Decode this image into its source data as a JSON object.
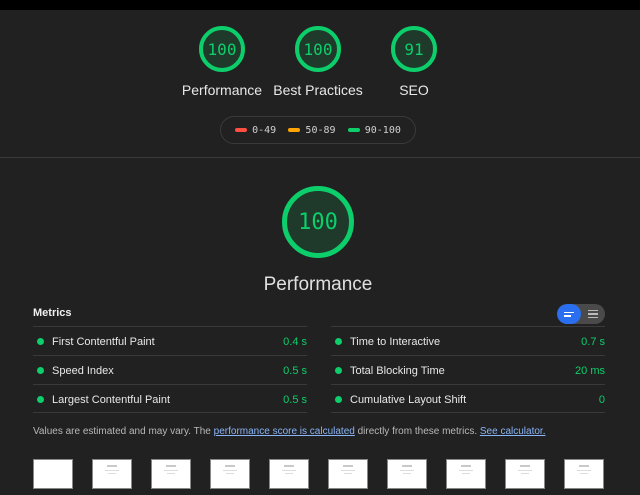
{
  "categories": [
    {
      "score": "100",
      "label": "Performance"
    },
    {
      "score": "100",
      "label": "Best Practices"
    },
    {
      "score": "91",
      "label": "SEO"
    }
  ],
  "legend": [
    {
      "range": "0-49",
      "color": "#ff4e42"
    },
    {
      "range": "50-89",
      "color": "#ffa400"
    },
    {
      "range": "90-100",
      "color": "#0cce6b"
    }
  ],
  "main": {
    "score": "100",
    "label": "Performance"
  },
  "metrics": {
    "title": "Metrics",
    "left": [
      {
        "name": "First Contentful Paint",
        "value": "0.4 s"
      },
      {
        "name": "Speed Index",
        "value": "0.5 s"
      },
      {
        "name": "Largest Contentful Paint",
        "value": "0.5 s"
      }
    ],
    "right": [
      {
        "name": "Time to Interactive",
        "value": "0.7 s"
      },
      {
        "name": "Total Blocking Time",
        "value": "20 ms"
      },
      {
        "name": "Cumulative Layout Shift",
        "value": "0"
      }
    ]
  },
  "note": {
    "prefix": "Values are estimated and may vary. The ",
    "link1": "performance score is calculated",
    "middle": " directly from these metrics. ",
    "link2": "See calculator."
  },
  "colors": {
    "pass": "#0cce6b",
    "accent": "#2a6ff0"
  },
  "filmstrip_frames": 10
}
